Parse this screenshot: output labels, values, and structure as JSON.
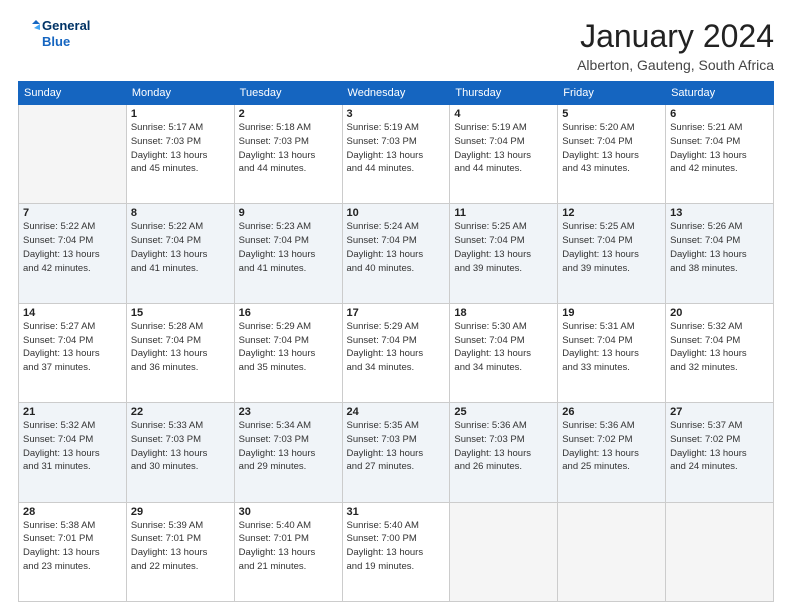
{
  "logo": {
    "line1": "General",
    "line2": "Blue"
  },
  "title": "January 2024",
  "location": "Alberton, Gauteng, South Africa",
  "days_of_week": [
    "Sunday",
    "Monday",
    "Tuesday",
    "Wednesday",
    "Thursday",
    "Friday",
    "Saturday"
  ],
  "weeks": [
    [
      {
        "num": "",
        "info": ""
      },
      {
        "num": "1",
        "info": "Sunrise: 5:17 AM\nSunset: 7:03 PM\nDaylight: 13 hours\nand 45 minutes."
      },
      {
        "num": "2",
        "info": "Sunrise: 5:18 AM\nSunset: 7:03 PM\nDaylight: 13 hours\nand 44 minutes."
      },
      {
        "num": "3",
        "info": "Sunrise: 5:19 AM\nSunset: 7:03 PM\nDaylight: 13 hours\nand 44 minutes."
      },
      {
        "num": "4",
        "info": "Sunrise: 5:19 AM\nSunset: 7:04 PM\nDaylight: 13 hours\nand 44 minutes."
      },
      {
        "num": "5",
        "info": "Sunrise: 5:20 AM\nSunset: 7:04 PM\nDaylight: 13 hours\nand 43 minutes."
      },
      {
        "num": "6",
        "info": "Sunrise: 5:21 AM\nSunset: 7:04 PM\nDaylight: 13 hours\nand 42 minutes."
      }
    ],
    [
      {
        "num": "7",
        "info": "Sunrise: 5:22 AM\nSunset: 7:04 PM\nDaylight: 13 hours\nand 42 minutes."
      },
      {
        "num": "8",
        "info": "Sunrise: 5:22 AM\nSunset: 7:04 PM\nDaylight: 13 hours\nand 41 minutes."
      },
      {
        "num": "9",
        "info": "Sunrise: 5:23 AM\nSunset: 7:04 PM\nDaylight: 13 hours\nand 41 minutes."
      },
      {
        "num": "10",
        "info": "Sunrise: 5:24 AM\nSunset: 7:04 PM\nDaylight: 13 hours\nand 40 minutes."
      },
      {
        "num": "11",
        "info": "Sunrise: 5:25 AM\nSunset: 7:04 PM\nDaylight: 13 hours\nand 39 minutes."
      },
      {
        "num": "12",
        "info": "Sunrise: 5:25 AM\nSunset: 7:04 PM\nDaylight: 13 hours\nand 39 minutes."
      },
      {
        "num": "13",
        "info": "Sunrise: 5:26 AM\nSunset: 7:04 PM\nDaylight: 13 hours\nand 38 minutes."
      }
    ],
    [
      {
        "num": "14",
        "info": "Sunrise: 5:27 AM\nSunset: 7:04 PM\nDaylight: 13 hours\nand 37 minutes."
      },
      {
        "num": "15",
        "info": "Sunrise: 5:28 AM\nSunset: 7:04 PM\nDaylight: 13 hours\nand 36 minutes."
      },
      {
        "num": "16",
        "info": "Sunrise: 5:29 AM\nSunset: 7:04 PM\nDaylight: 13 hours\nand 35 minutes."
      },
      {
        "num": "17",
        "info": "Sunrise: 5:29 AM\nSunset: 7:04 PM\nDaylight: 13 hours\nand 34 minutes."
      },
      {
        "num": "18",
        "info": "Sunrise: 5:30 AM\nSunset: 7:04 PM\nDaylight: 13 hours\nand 34 minutes."
      },
      {
        "num": "19",
        "info": "Sunrise: 5:31 AM\nSunset: 7:04 PM\nDaylight: 13 hours\nand 33 minutes."
      },
      {
        "num": "20",
        "info": "Sunrise: 5:32 AM\nSunset: 7:04 PM\nDaylight: 13 hours\nand 32 minutes."
      }
    ],
    [
      {
        "num": "21",
        "info": "Sunrise: 5:32 AM\nSunset: 7:04 PM\nDaylight: 13 hours\nand 31 minutes."
      },
      {
        "num": "22",
        "info": "Sunrise: 5:33 AM\nSunset: 7:03 PM\nDaylight: 13 hours\nand 30 minutes."
      },
      {
        "num": "23",
        "info": "Sunrise: 5:34 AM\nSunset: 7:03 PM\nDaylight: 13 hours\nand 29 minutes."
      },
      {
        "num": "24",
        "info": "Sunrise: 5:35 AM\nSunset: 7:03 PM\nDaylight: 13 hours\nand 27 minutes."
      },
      {
        "num": "25",
        "info": "Sunrise: 5:36 AM\nSunset: 7:03 PM\nDaylight: 13 hours\nand 26 minutes."
      },
      {
        "num": "26",
        "info": "Sunrise: 5:36 AM\nSunset: 7:02 PM\nDaylight: 13 hours\nand 25 minutes."
      },
      {
        "num": "27",
        "info": "Sunrise: 5:37 AM\nSunset: 7:02 PM\nDaylight: 13 hours\nand 24 minutes."
      }
    ],
    [
      {
        "num": "28",
        "info": "Sunrise: 5:38 AM\nSunset: 7:01 PM\nDaylight: 13 hours\nand 23 minutes."
      },
      {
        "num": "29",
        "info": "Sunrise: 5:39 AM\nSunset: 7:01 PM\nDaylight: 13 hours\nand 22 minutes."
      },
      {
        "num": "30",
        "info": "Sunrise: 5:40 AM\nSunset: 7:01 PM\nDaylight: 13 hours\nand 21 minutes."
      },
      {
        "num": "31",
        "info": "Sunrise: 5:40 AM\nSunset: 7:00 PM\nDaylight: 13 hours\nand 19 minutes."
      },
      {
        "num": "",
        "info": ""
      },
      {
        "num": "",
        "info": ""
      },
      {
        "num": "",
        "info": ""
      }
    ]
  ]
}
